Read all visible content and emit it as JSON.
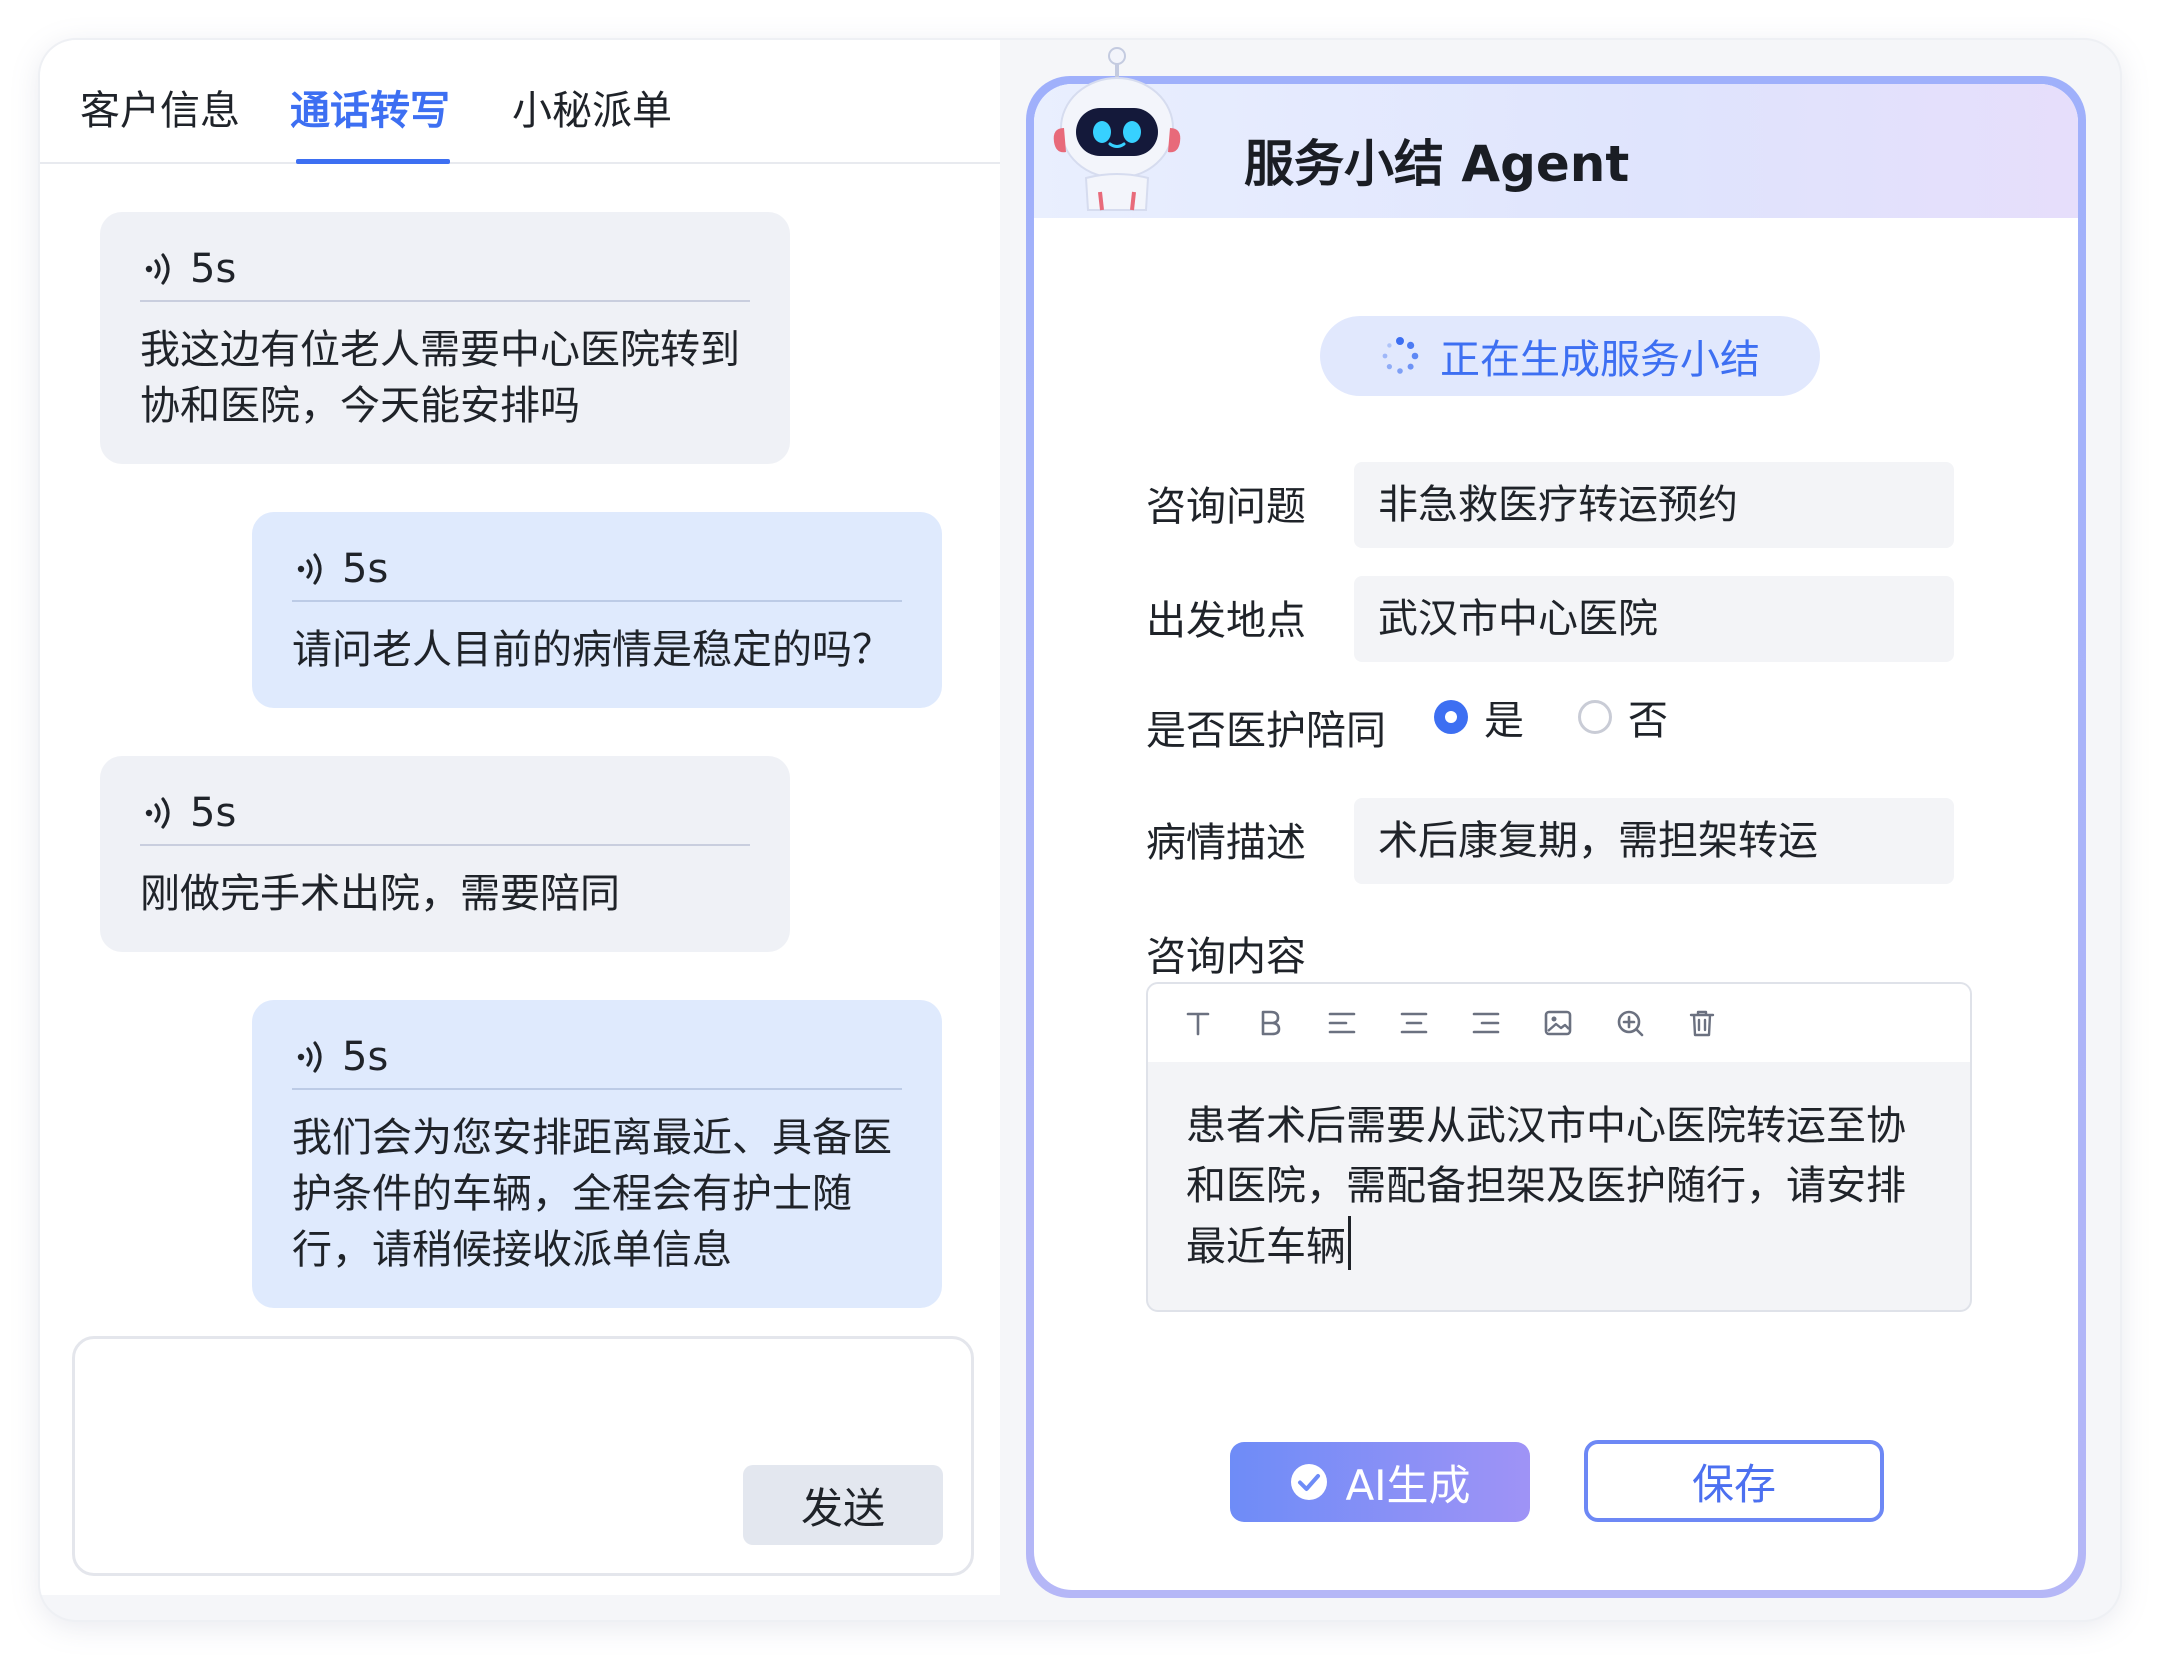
{
  "tabs": [
    {
      "label": "客户信息"
    },
    {
      "label": "通话转写"
    },
    {
      "label": "小秘派单"
    }
  ],
  "messages": [
    {
      "role": "customer",
      "duration": "5s",
      "text": "我这边有位老人需要中心医院转到协和医院，今天能安排吗"
    },
    {
      "role": "agent",
      "duration": "5s",
      "text": "请问老人目前的病情是稳定的吗？"
    },
    {
      "role": "customer",
      "duration": "5s",
      "text": "刚做完手术出院，需要陪同"
    },
    {
      "role": "agent",
      "duration": "5s",
      "text": "我们会为您安排距离最近、具备医护条件的车辆，全程会有护士随行，请稍候接收派单信息"
    }
  ],
  "input": {
    "send_label": "发送"
  },
  "agent_panel": {
    "title": "服务小结 Agent",
    "status": "正在生成服务小结",
    "fields": {
      "question_label": "咨询问题",
      "question_value": "非急救医疗转运预约",
      "origin_label": "出发地点",
      "origin_value": "武汉市中心医院",
      "escort_label": "是否医护陪同",
      "escort_yes": "是",
      "escort_no": "否",
      "escort_selected": "是",
      "condition_label": "病情描述",
      "condition_value": "术后康复期，需担架转运",
      "content_label": "咨询内容",
      "content_value": "患者术后需要从武汉市中心医院转运至协和医院，需配备担架及医护随行，请安排最近车辆"
    },
    "toolbar_icons": [
      "text-icon",
      "bold-icon",
      "align-left-icon",
      "align-center-icon",
      "align-right-icon",
      "image-icon",
      "zoom-in-icon",
      "delete-icon"
    ],
    "ai_button": "AI生成",
    "save_button": "保存"
  },
  "colors": {
    "accent": "#3d6ff2",
    "agent_bubble": "#dfeafd",
    "customer_bubble": "#eff1f6",
    "panel_border": "#9fb0fb"
  }
}
